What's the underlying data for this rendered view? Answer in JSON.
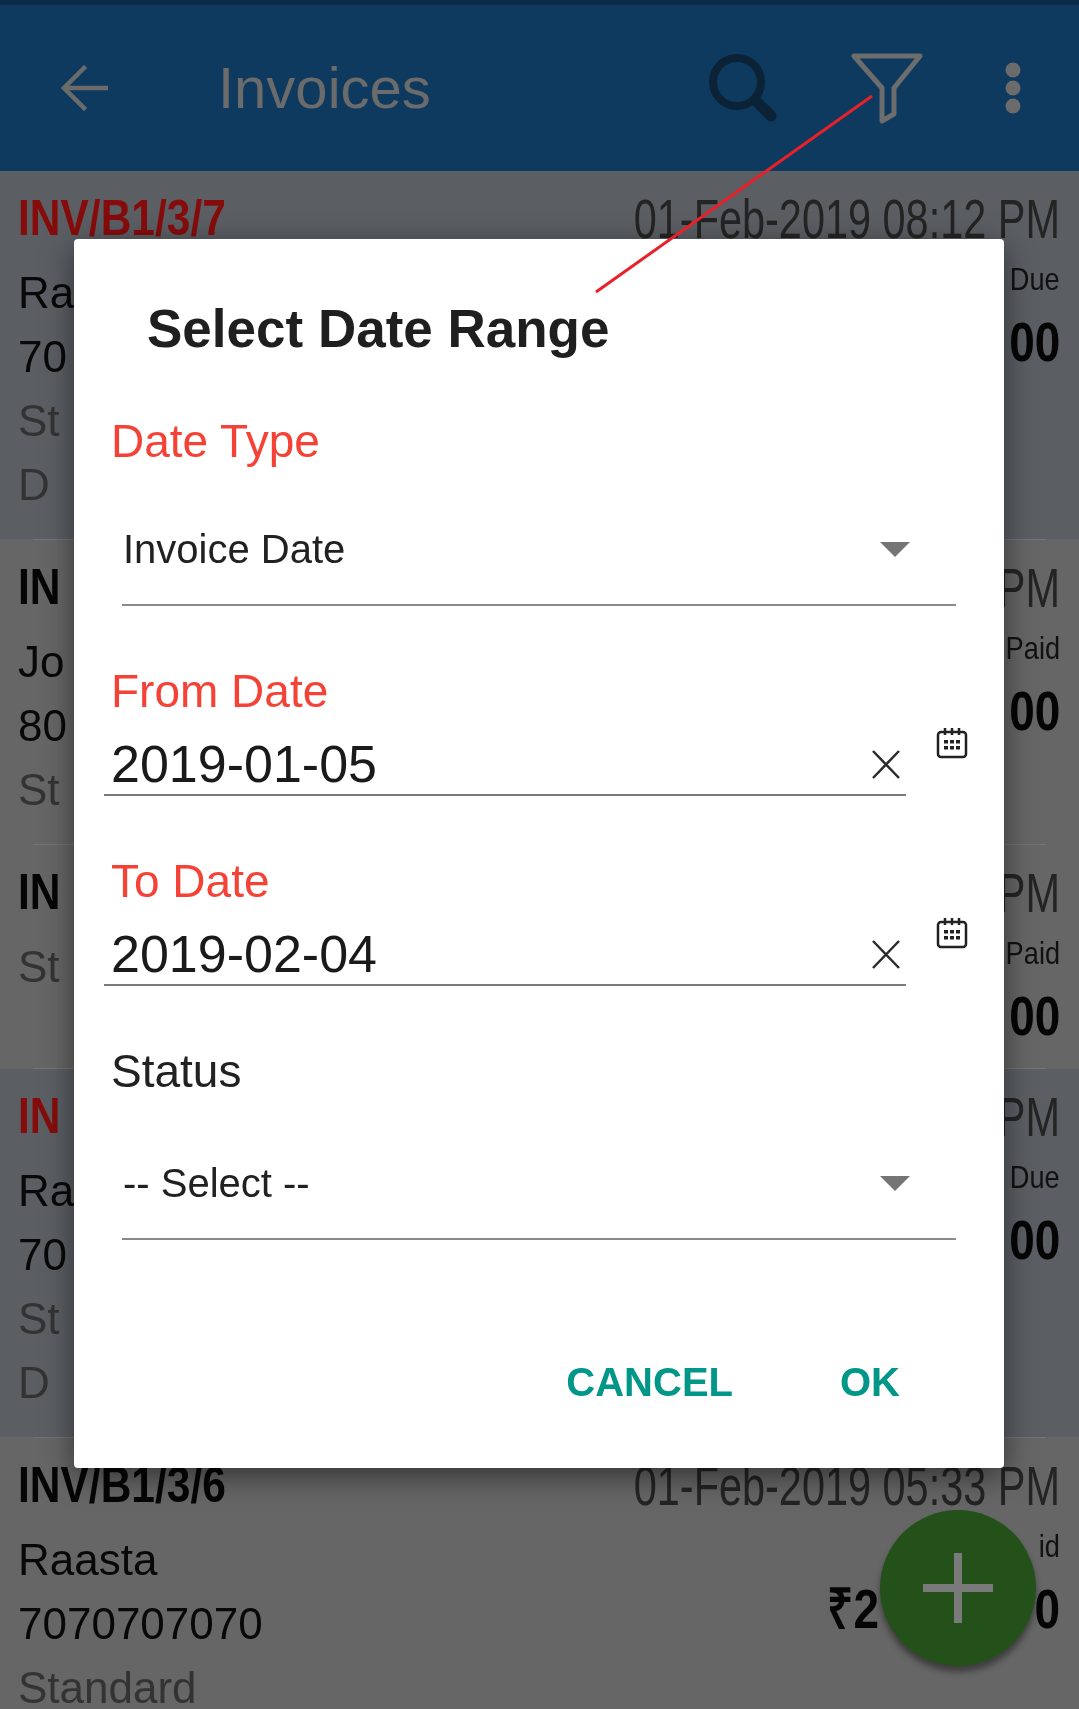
{
  "app_bar": {
    "title": "Invoices"
  },
  "invoices": [
    {
      "kind": "due",
      "number": "INV/B1/3/7",
      "date": "01-Feb-2019 08:12 PM",
      "lines": [
        {
          "text": "Ra",
          "muted": false
        },
        {
          "text": "70",
          "muted": false
        },
        {
          "text": "St",
          "muted": true
        },
        {
          "text": "D",
          "muted": true
        }
      ],
      "status": "Due",
      "amount": [
        "00"
      ]
    },
    {
      "kind": "paid",
      "number": "IN",
      "date": "PM",
      "lines": [
        {
          "text": "Jo",
          "muted": false
        },
        {
          "text": "80",
          "muted": false
        },
        {
          "text": "St",
          "muted": true
        }
      ],
      "status": "Paid",
      "amount": [
        "00"
      ]
    },
    {
      "kind": "paid",
      "number": "IN",
      "date": "PM",
      "lines": [
        {
          "text": "St",
          "muted": true
        }
      ],
      "status": "Paid",
      "amount": [
        "00"
      ]
    },
    {
      "kind": "due",
      "number": "IN",
      "date": "PM",
      "lines": [
        {
          "text": "Ra",
          "muted": false
        },
        {
          "text": "70",
          "muted": false
        },
        {
          "text": "St",
          "muted": true
        },
        {
          "text": "D",
          "muted": true
        }
      ],
      "status": "Due",
      "amount": [
        "00"
      ]
    },
    {
      "kind": "paid",
      "number": "INV/B1/3/6",
      "date": "01-Feb-2019 05:33 PM",
      "lines": [
        {
          "text": "Raasta",
          "muted": false
        },
        {
          "text": "7070707070",
          "muted": false
        },
        {
          "text": "Standard",
          "muted": true
        }
      ],
      "status": "id",
      "amount": [
        "₹2",
        "0"
      ]
    }
  ],
  "dialog": {
    "title": "Select Date Range",
    "fields": [
      {
        "kind": "dropdown",
        "label": "Date Type",
        "highlighted": true,
        "value": "Invoice Date"
      },
      {
        "kind": "date",
        "label": "From Date",
        "highlighted": true,
        "value": "2019-01-05"
      },
      {
        "kind": "date",
        "label": "To Date",
        "highlighted": true,
        "value": "2019-02-04"
      },
      {
        "kind": "dropdown",
        "label": "Status",
        "highlighted": false,
        "value": "-- Select --"
      }
    ],
    "buttons": [
      "CANCEL",
      "OK"
    ]
  }
}
